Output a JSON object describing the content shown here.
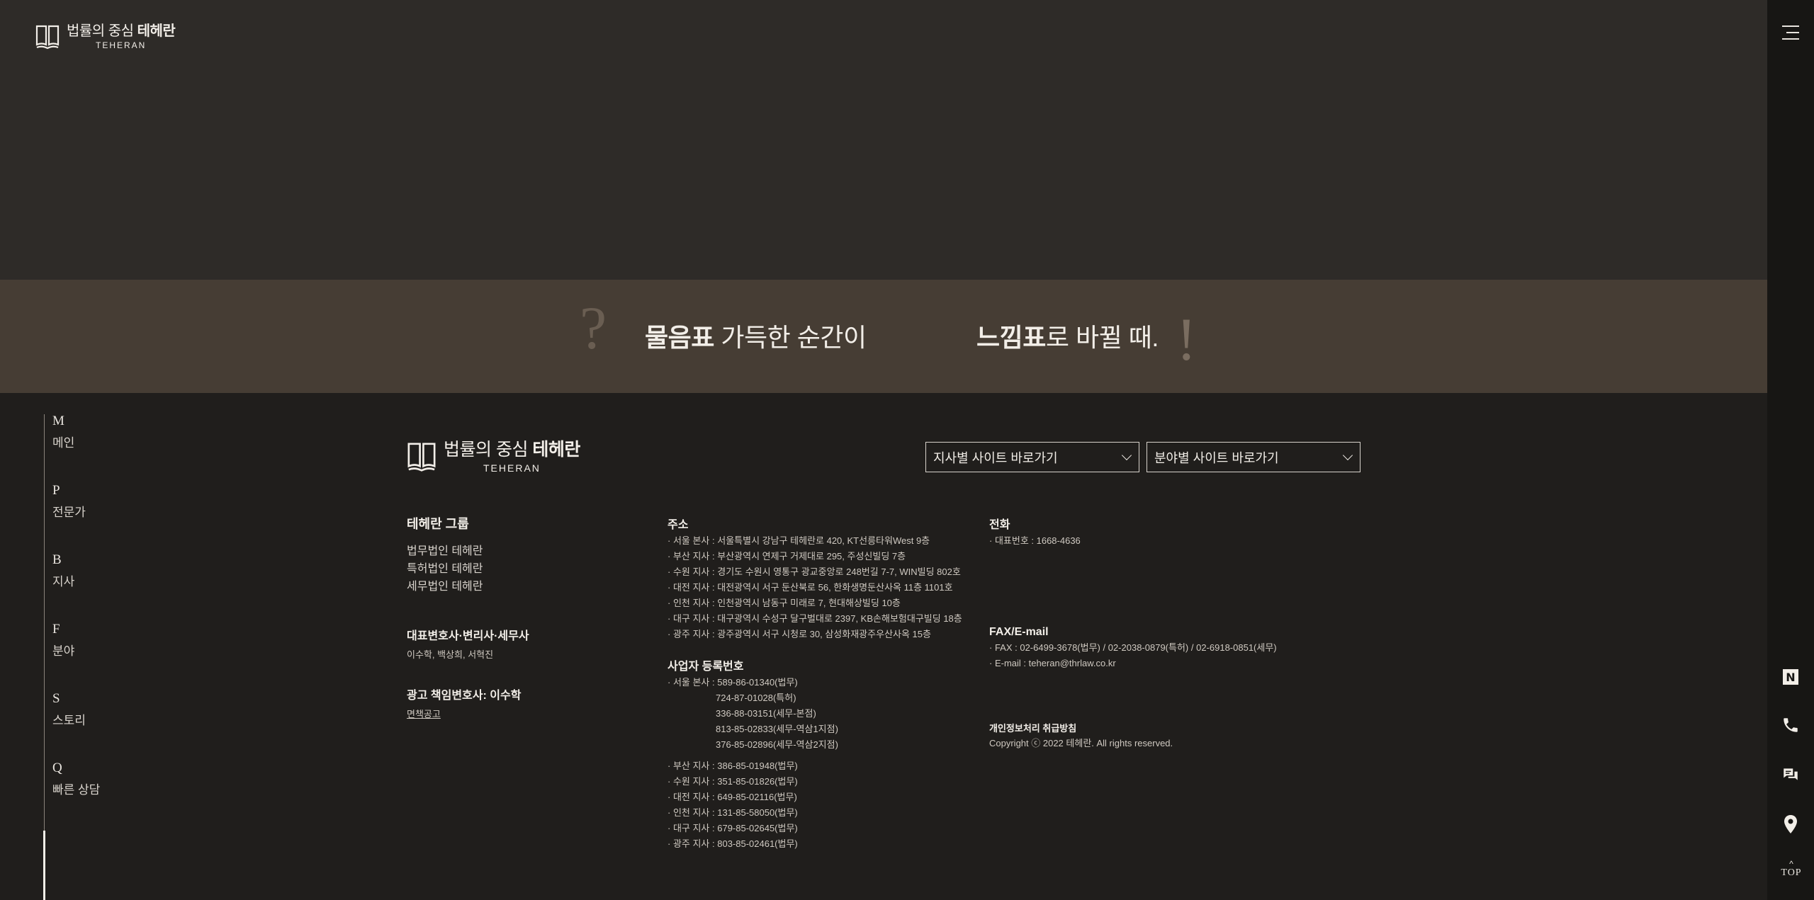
{
  "brand": {
    "name_prefix": "법률의 중심",
    "name_main": "테헤란",
    "name_en": "TEHERAN"
  },
  "slogan": {
    "q_symbol": "?",
    "left_bold": "물음표",
    "left_rest": " 가득한 순간이",
    "right_bold": "느낌표",
    "right_rest": "로 바뀔 때.",
    "e_symbol": "!"
  },
  "sidenav": [
    {
      "letter": "M",
      "label": "메인"
    },
    {
      "letter": "P",
      "label": "전문가"
    },
    {
      "letter": "B",
      "label": "지사"
    },
    {
      "letter": "F",
      "label": "분야"
    },
    {
      "letter": "S",
      "label": "스토리"
    },
    {
      "letter": "Q",
      "label": "빠른 상담"
    }
  ],
  "selects": {
    "branch": "지사별 사이트 바로가기",
    "field": "분야별 사이트 바로가기"
  },
  "group": {
    "title": "테헤란 그룹",
    "links": [
      "법무법인 테헤란",
      "특허법인 테헤란",
      "세무법인 테헤란"
    ]
  },
  "reps": {
    "title": "대표변호사·변리사·세무사",
    "names": "이수학, 백상희, 서혁진"
  },
  "ad": {
    "title": "광고 책임변호사: 이수학",
    "disclaimer": "면책공고"
  },
  "address": {
    "title": "주소",
    "lines": [
      "· 서울 본사 : 서울특별시 강남구 테헤란로 420, KT선릉타워West 9층",
      "· 부산 지사 : 부산광역시 연제구 거제대로 295, 주성신빌딩 7층",
      "· 수원 지사 : 경기도 수원시 영통구 광교중앙로 248번길 7-7, WIN빌딩 802호",
      "· 대전 지사 : 대전광역시 서구 둔산북로 56, 한화생명둔산사옥 11층 1101호",
      "· 인천 지사 : 인천광역시 남동구 미래로 7, 현대해상빌딩 10층",
      "· 대구 지사 : 대구광역시 수성구 달구벌대로 2397, KB손해보험대구빌딩 18층",
      "· 광주 지사 : 광주광역시 서구 시청로 30, 삼성화재광주우산사옥 15층"
    ]
  },
  "bizreg": {
    "title": "사업자 등록번호",
    "seoul_label": "· 서울 본사 : 589-86-01340(법무)",
    "seoul_more": [
      "724-87-01028(특허)",
      "336-88-03151(세무-본점)",
      "813-85-02833(세무-역삼1지점)",
      "376-85-02896(세무-역삼2지점)"
    ],
    "branches": [
      "· 부산 지사 : 386-85-01948(법무)",
      "· 수원 지사 : 351-85-01826(법무)",
      "· 대전 지사 : 649-85-02116(법무)",
      "· 인천 지사 : 131-85-58050(법무)",
      "· 대구 지사 : 679-85-02645(법무)",
      "· 광주 지사 : 803-85-02461(법무)"
    ]
  },
  "phone": {
    "title": "전화",
    "line": "· 대표번호 : 1668-4636"
  },
  "fax": {
    "title": "FAX/E-mail",
    "fax_line": "· FAX : 02-6499-3678(법무) / 02-2038-0879(특허) / 02-6918-0851(세무)",
    "email_line": "· E-mail : teheran@thrlaw.co.kr"
  },
  "privacy": {
    "title": "개인정보처리 취급방침",
    "copyright": "Copyright ⓒ 2022 테헤란. All rights reserved."
  },
  "rail": {
    "naver_letter": "N",
    "top_label": "TOP",
    "top_chevron": "^"
  },
  "icons": [
    "book-logo-icon",
    "hamburger-icon",
    "naver-blog-icon",
    "phone-icon",
    "chat-icon",
    "location-pin-icon",
    "chevron-up-icon",
    "chevron-down-icon"
  ]
}
